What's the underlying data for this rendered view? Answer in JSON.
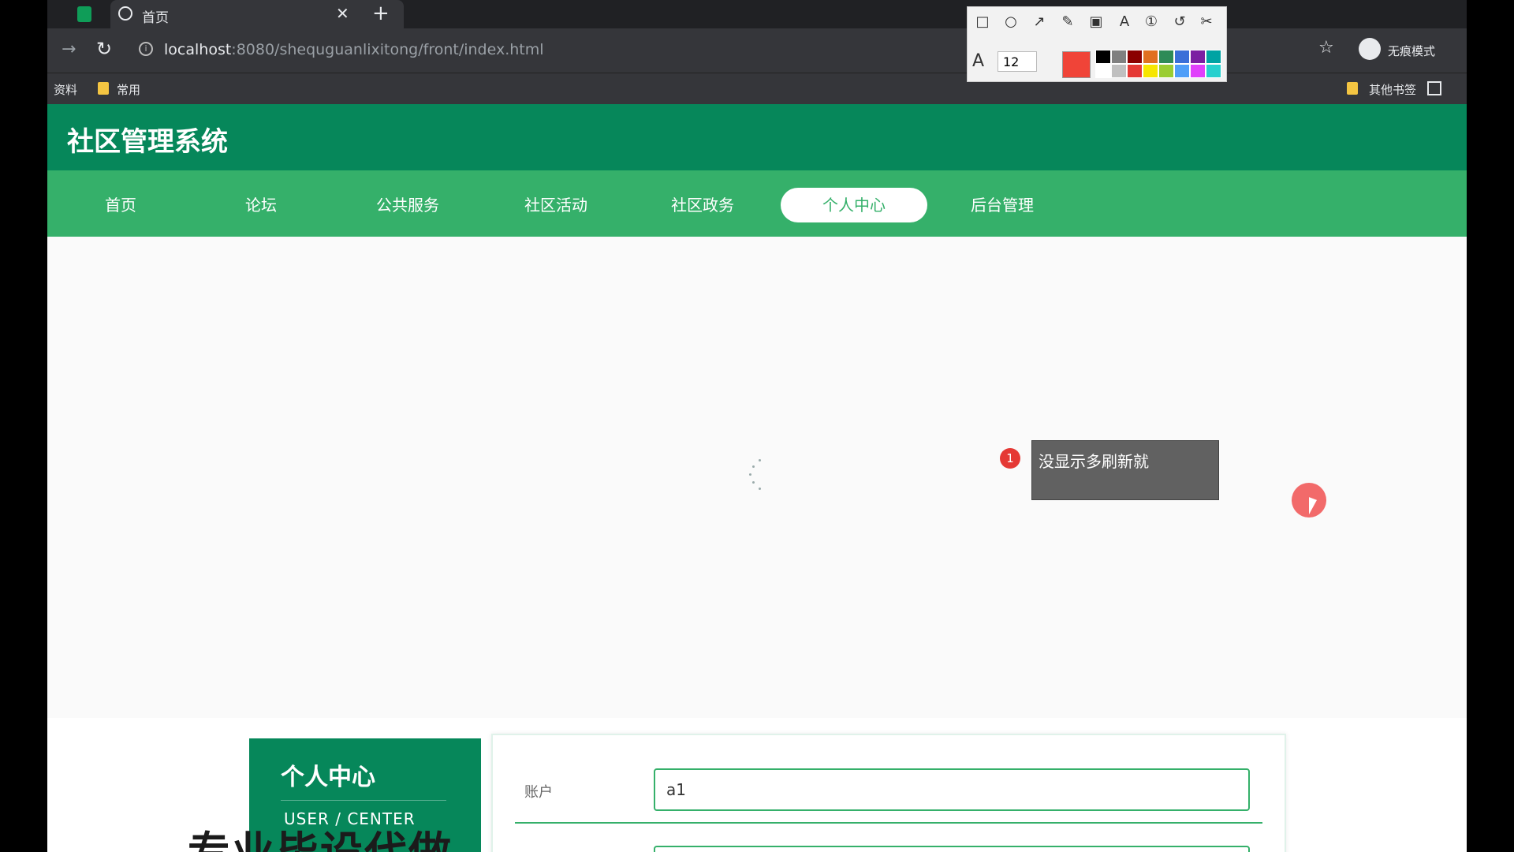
{
  "browser": {
    "tab_title": "首页",
    "tab_close": "✕",
    "tab_new": "+",
    "url_host": "localhost",
    "url_path": ":8080/shequguanlixitong/front/index.html",
    "incognito_label": "无痕模式",
    "bookmarks": [
      {
        "label": "资料"
      },
      {
        "label": "常用"
      },
      {
        "label": "其他书签"
      }
    ]
  },
  "annotation_toolbar": {
    "font_size": "12",
    "current_color": "#f04438",
    "palette": [
      "#000000",
      "#808080",
      "#8b0000",
      "#e07020",
      "#2e8b57",
      "#3a6fd8",
      "#7b1fa2",
      "#00a3a3",
      "#ffffff",
      "#c0c0c0",
      "#e53935",
      "#f7e600",
      "#9acd32",
      "#4f9ef8",
      "#e040fb",
      "#26d0ce"
    ]
  },
  "site": {
    "title": "社区管理系统",
    "nav": [
      {
        "label": "首页"
      },
      {
        "label": "论坛"
      },
      {
        "label": "公共服务"
      },
      {
        "label": "社区活动"
      },
      {
        "label": "社区政务"
      },
      {
        "label": "个人中心",
        "active": true
      },
      {
        "label": "后台管理"
      }
    ]
  },
  "callout": {
    "badge": "1",
    "text": "没显示多刷新就"
  },
  "user_center": {
    "title": "个人中心",
    "subtitle": "USER / CENTER"
  },
  "form": {
    "account_label": "账户",
    "account_value": "a1"
  },
  "watermark": "专业毕设代做"
}
